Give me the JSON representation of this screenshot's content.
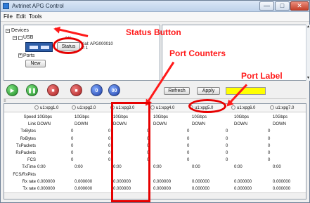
{
  "window": {
    "title": "Avtrinet APG Control",
    "min_icon": "—",
    "max_icon": "□",
    "close_icon": "✕"
  },
  "menu": {
    "file": "File",
    "edit": "Edit",
    "tools": "Tools"
  },
  "devices": {
    "root": "Devices",
    "usb_label": "USB",
    "usb_suffix": "AB",
    "serial_line1": "rial: APG000010",
    "serial_line2": "it 1",
    "status_button": "Status",
    "ports_label": "Ports",
    "new_button": "New"
  },
  "toolbar": {
    "refresh": "Refresh",
    "apply": "Apply",
    "port_label_value": ""
  },
  "grid": {
    "columns": [
      "u1:xpg1.0",
      "u1:xpg2.0",
      "u1:xpg3.0",
      "u1:xpg4.0",
      "u1:xpg5.0",
      "u1:xpg6.0",
      "u1:xpg7.0"
    ],
    "rows": [
      {
        "label": "Speed",
        "values": [
          "10Gbps",
          "10Gbps",
          "10Gbps",
          "10Gbps",
          "10Gbps",
          "10Gbps",
          "10Gbps"
        ]
      },
      {
        "label": "Link",
        "values": [
          "DOWN",
          "DOWN",
          "DOWN",
          "DOWN",
          "DOWN",
          "DOWN",
          "DOWN"
        ]
      },
      {
        "label": "TxBytes",
        "values": [
          "0",
          "0",
          "0",
          "0",
          "0",
          "0",
          "0"
        ]
      },
      {
        "label": "RxBytes",
        "values": [
          "0",
          "0",
          "0",
          "0",
          "0",
          "0",
          "0"
        ]
      },
      {
        "label": "TxPackets",
        "values": [
          "0",
          "0",
          "0",
          "0",
          "0",
          "0",
          "0"
        ]
      },
      {
        "label": "RxPackets",
        "values": [
          "0",
          "0",
          "0",
          "0",
          "0",
          "0",
          "0"
        ]
      },
      {
        "label": "FCS",
        "values": [
          "0",
          "0",
          "0",
          "0",
          "0",
          "0",
          "0"
        ]
      },
      {
        "label": "TxTime",
        "values": [
          "0:00",
          "0:00",
          "0:00",
          "0:00",
          "0:00",
          "0:00",
          "0:00"
        ]
      },
      {
        "label": "FCS/RxPkts",
        "values": [
          "",
          "",
          "",
          "",
          "",
          "",
          ""
        ]
      },
      {
        "label": "Rx rate",
        "values": [
          "0.000000",
          "0.000000",
          "0.000000",
          "0.000000",
          "0.000000",
          "0.000000",
          "0.000000"
        ]
      },
      {
        "label": "Tx rate",
        "values": [
          "0.000000",
          "0.000000",
          "0.000000",
          "0.000000",
          "0.000000",
          "0.000000",
          "0.000000"
        ]
      }
    ]
  },
  "annotations": {
    "status_button": "Status Button",
    "port_counters": "Port Counters",
    "port_label": "Port Label"
  },
  "colors": {
    "annotation_red": "#e60000",
    "label_yellow": "#ffff00"
  }
}
